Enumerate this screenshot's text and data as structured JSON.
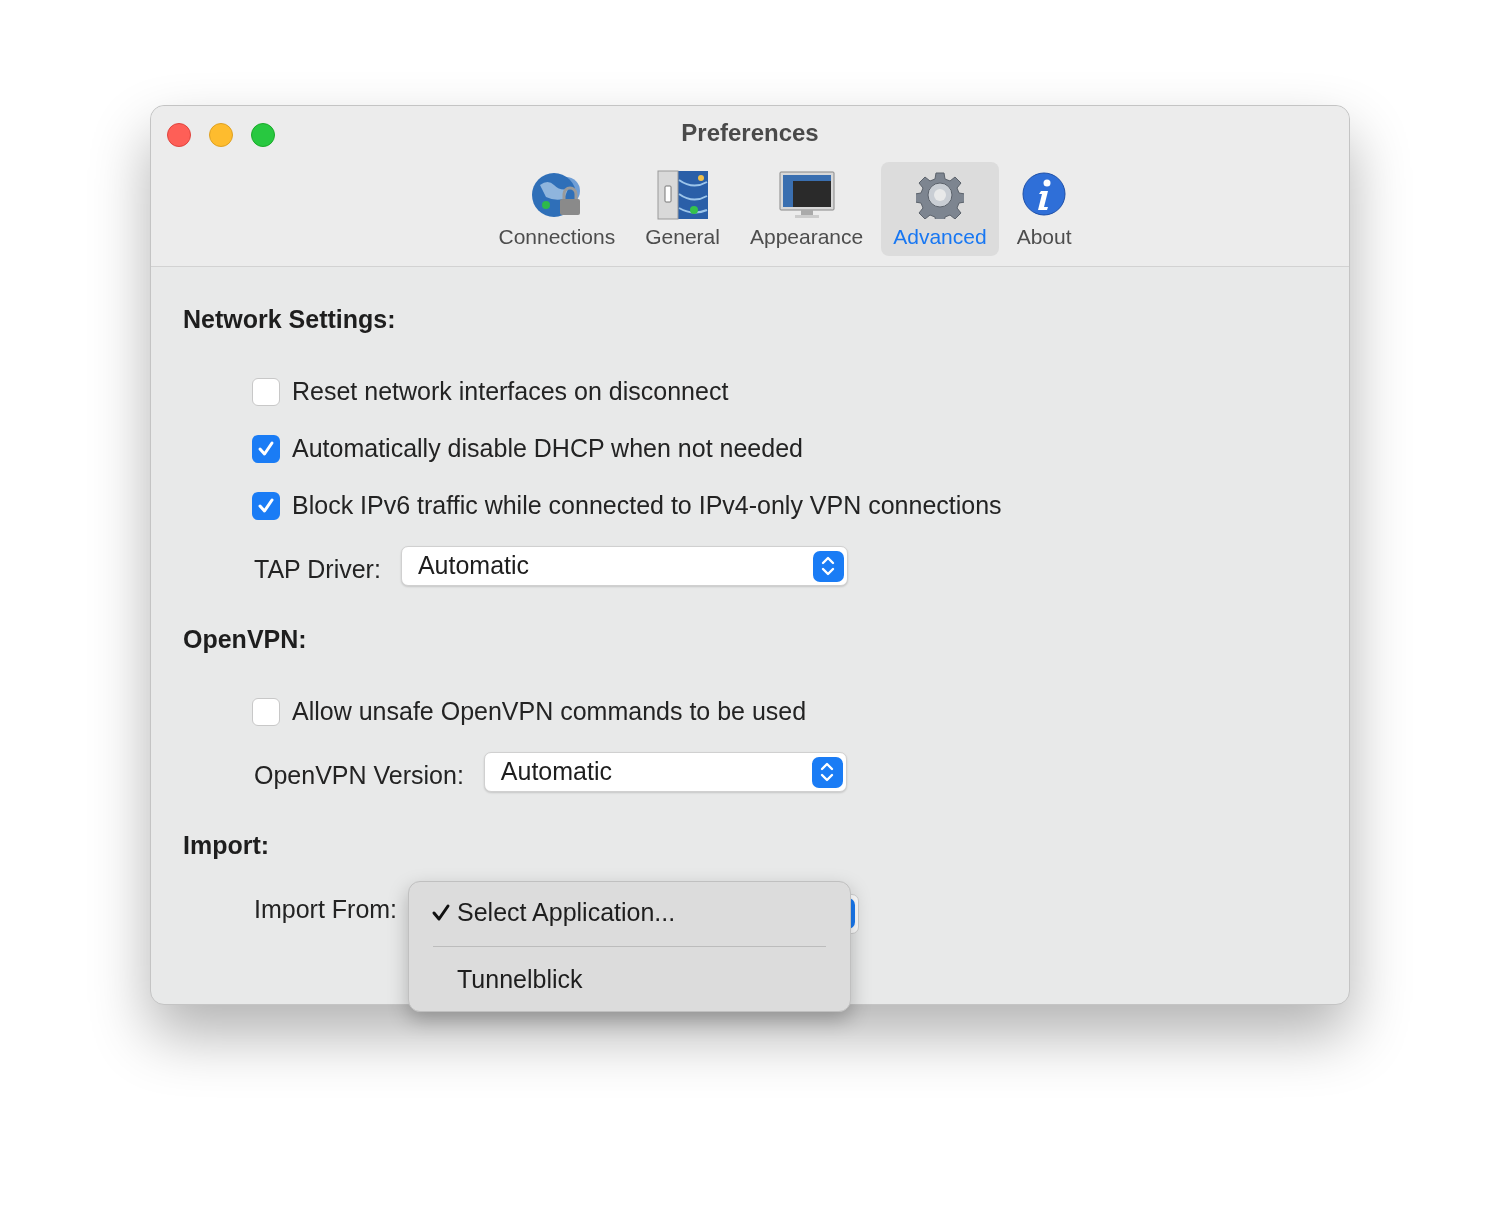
{
  "window": {
    "title": "Preferences"
  },
  "toolbar": [
    {
      "label": "Connections",
      "kind": "globe",
      "selected": false
    },
    {
      "label": "General",
      "kind": "switch",
      "selected": false
    },
    {
      "label": "Appearance",
      "kind": "monitor",
      "selected": false
    },
    {
      "label": "Advanced",
      "kind": "gear",
      "selected": true
    },
    {
      "label": "About",
      "kind": "info",
      "selected": false
    }
  ],
  "sections": [
    {
      "title": "Network Settings:",
      "items": [
        {
          "kind": "checkbox",
          "label": "Reset network interfaces on disconnect",
          "checked": false
        },
        {
          "kind": "checkbox",
          "label": "Automatically disable DHCP when not needed",
          "checked": true
        },
        {
          "kind": "checkbox",
          "label": "Block IPv6 traffic while connected to IPv4-only VPN connections",
          "checked": true
        },
        {
          "kind": "popup",
          "label": "TAP Driver:",
          "value": "Automatic"
        }
      ]
    },
    {
      "title": "OpenVPN:",
      "items": [
        {
          "kind": "checkbox",
          "label": "Allow unsafe OpenVPN commands to be used",
          "checked": false
        },
        {
          "kind": "popup",
          "label": "OpenVPN Version:",
          "value": "Automatic"
        }
      ]
    },
    {
      "title": "Import:",
      "items": [
        {
          "kind": "menu",
          "label": "Import From:",
          "options": [
            {
              "label": "Select Application...",
              "selected": true
            },
            {
              "label": "Tunnelblick",
              "selected": false
            }
          ]
        }
      ]
    }
  ]
}
